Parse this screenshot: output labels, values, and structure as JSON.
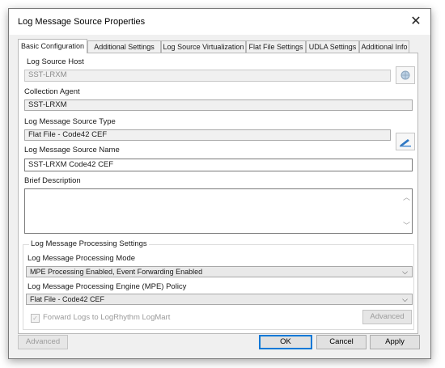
{
  "window": {
    "title": "Log Message Source Properties",
    "close_glyph": "✕"
  },
  "tabs": [
    {
      "label": "Basic Configuration"
    },
    {
      "label": "Additional Settings"
    },
    {
      "label": "Log Source Virtualization"
    },
    {
      "label": "Flat File Settings"
    },
    {
      "label": "UDLA Settings"
    },
    {
      "label": "Additional Info"
    }
  ],
  "form": {
    "log_source_host": {
      "label": "Log Source Host",
      "value": "SST-LRXM"
    },
    "collection_agent": {
      "label": "Collection Agent",
      "value": "SST-LRXM"
    },
    "log_message_source_type": {
      "label": "Log Message Source Type",
      "value": "Flat File - Code42 CEF"
    },
    "log_message_source_name": {
      "label": "Log Message Source Name",
      "value": "SST-LRXM Code42 CEF"
    },
    "brief_description": {
      "label": "Brief Description",
      "value": ""
    }
  },
  "processing": {
    "group_label": "Log Message Processing Settings",
    "mode_label": "Log Message Processing Mode",
    "mode_value": "MPE Processing Enabled, Event Forwarding Enabled",
    "policy_label": "Log Message Processing Engine (MPE) Policy",
    "policy_value": "Flat File - Code42 CEF",
    "forward_label": "Forward Logs to LogRhythm LogMart",
    "forward_checked": true,
    "advanced_label": "Advanced"
  },
  "footer": {
    "advanced_label": "Advanced",
    "ok_label": "OK",
    "cancel_label": "Cancel",
    "apply_label": "Apply"
  },
  "icons": {
    "host_browse": "globe-search-icon",
    "type_browse": "edit-type-icon"
  },
  "colors": {
    "accent": "#0078d7",
    "panel_bg": "#f0f0f0",
    "field_ro": "#f0f0f0"
  }
}
